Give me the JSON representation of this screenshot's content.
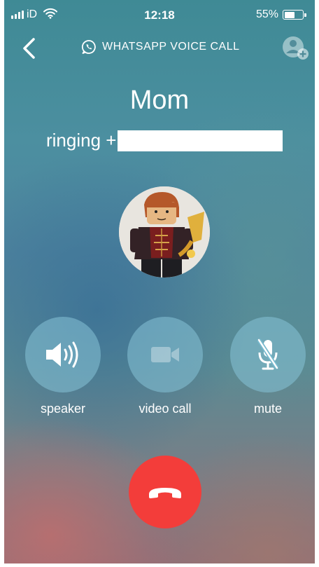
{
  "status_bar": {
    "carrier": "iD",
    "time": "12:18",
    "battery_percent": "55%",
    "battery_level": 0.55
  },
  "header": {
    "title": "WHATSAPP VOICE CALL",
    "back_icon": "chevron-left-icon",
    "brand_icon": "whatsapp-icon",
    "add_participant_icon": "add-person-icon"
  },
  "call": {
    "contact_name": "Mom",
    "status_text": "ringing +"
  },
  "controls": {
    "speaker": {
      "label": "speaker",
      "icon": "speaker-icon"
    },
    "video": {
      "label": "video call",
      "icon": "video-camera-icon"
    },
    "mute": {
      "label": "mute",
      "icon": "microphone-off-icon"
    },
    "end": {
      "icon": "hang-up-icon",
      "color": "#f33d3a"
    }
  },
  "colors": {
    "control_button": "#87c3d7",
    "text": "#ffffff"
  }
}
